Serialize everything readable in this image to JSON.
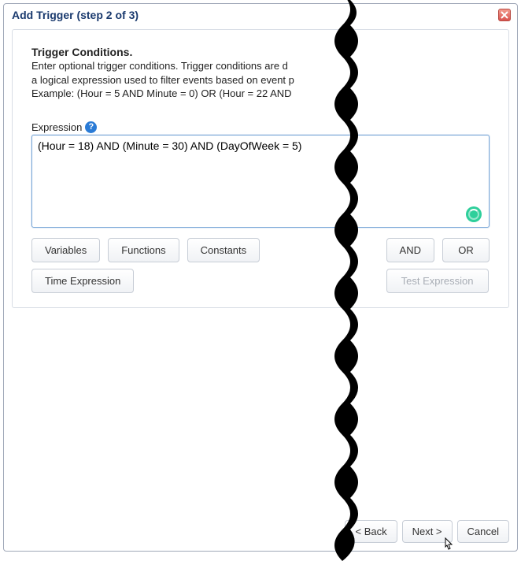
{
  "dialog": {
    "title": "Add Trigger (step 2 of 3)"
  },
  "trigger": {
    "title": "Trigger Conditions.",
    "desc_line1": "Enter optional trigger conditions. Trigger conditions are d",
    "desc_line2": "a logical expression used to filter events based on event p",
    "desc_line3": "Example: (Hour = 5 AND Minute = 0) OR (Hour = 22 AND"
  },
  "expression": {
    "label": "Expression",
    "value": "(Hour = 18) AND (Minute = 30) AND (DayOfWeek = 5)"
  },
  "buttons": {
    "variables": "Variables",
    "functions": "Functions",
    "constants": "Constants",
    "time_expression": "Time Expression",
    "and": "AND",
    "or": "OR",
    "test_expression": "Test Expression"
  },
  "footer": {
    "back": "< Back",
    "next": "Next >",
    "cancel": "Cancel"
  }
}
